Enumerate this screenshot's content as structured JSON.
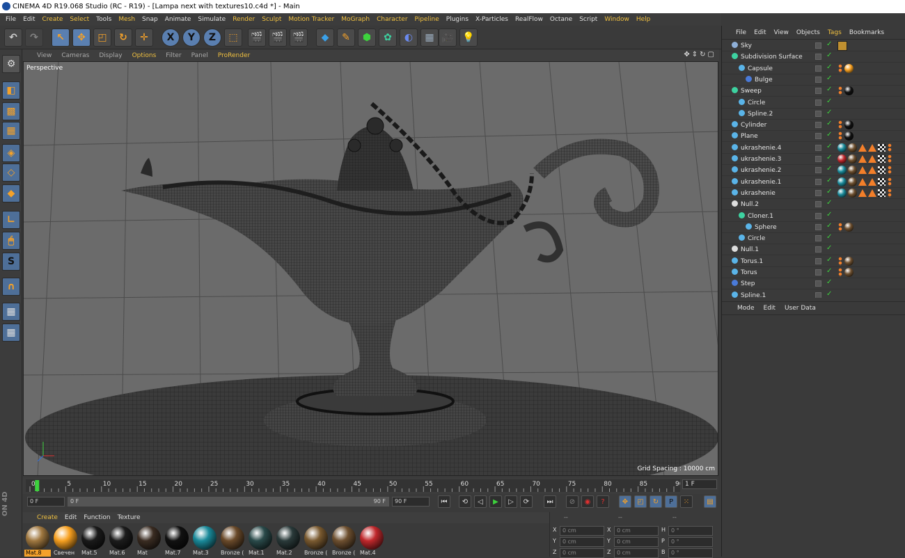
{
  "window": {
    "title": "CINEMA 4D R19.068 Studio (RC - R19) - [Lampa next with textures10.c4d *] - Main"
  },
  "menubar": [
    "File",
    "Edit",
    "Create",
    "Select",
    "Tools",
    "Mesh",
    "Snap",
    "Animate",
    "Simulate",
    "Render",
    "Sculpt",
    "Motion Tracker",
    "MoGraph",
    "Character",
    "Pipeline",
    "Plugins",
    "X-Particles",
    "RealFlow",
    "Octane",
    "Script",
    "Window",
    "Help"
  ],
  "toolbar": {
    "axis": [
      "X",
      "Y",
      "Z"
    ]
  },
  "viewport": {
    "menu": [
      "View",
      "Cameras",
      "Display",
      "Options",
      "Filter",
      "Panel",
      "ProRender"
    ],
    "label": "Perspective",
    "grid_spacing": "Grid Spacing : 10000 cm"
  },
  "timeline": {
    "ticks": [
      "0",
      "5",
      "10",
      "15",
      "20",
      "25",
      "30",
      "35",
      "40",
      "45",
      "50",
      "55",
      "60",
      "65",
      "70",
      "75",
      "80",
      "85",
      "90"
    ],
    "current_frame": "1 F",
    "start": "0 F",
    "range_start": "0 F",
    "range_end": "90 F",
    "end": "90 F"
  },
  "material_panel": {
    "menu": [
      "Create",
      "Edit",
      "Function",
      "Texture"
    ],
    "materials": [
      {
        "name": "Mat.8",
        "color": "#a07840"
      },
      {
        "name": "Свечен",
        "color": "#f7a020"
      },
      {
        "name": "Mat.5",
        "color": "#1a1a1a"
      },
      {
        "name": "Mat.6",
        "color": "#1c1c1c"
      },
      {
        "name": "Mat",
        "color": "#3a2c22"
      },
      {
        "name": "Mat.7",
        "color": "#111111"
      },
      {
        "name": "Mat.3",
        "color": "#1a8a9a"
      },
      {
        "name": "Bronze (",
        "color": "#6a4a2a"
      },
      {
        "name": "Mat.1",
        "color": "#2a4a4a"
      },
      {
        "name": "Mat.2",
        "color": "#2a3a3a"
      },
      {
        "name": "Bronze (",
        "color": "#7a5a30"
      },
      {
        "name": "Bronze (",
        "color": "#6e5030"
      },
      {
        "name": "Mat.4",
        "color": "#c0282c"
      }
    ]
  },
  "coords": {
    "headers": [
      "--",
      "--",
      "--"
    ],
    "rows": [
      {
        "a": "X",
        "av": "0 cm",
        "b": "X",
        "bv": "0 cm",
        "c": "H",
        "cv": "0 °"
      },
      {
        "a": "Y",
        "av": "0 cm",
        "b": "Y",
        "bv": "0 cm",
        "c": "P",
        "cv": "0 °"
      },
      {
        "a": "Z",
        "av": "0 cm",
        "b": "Z",
        "bv": "0 cm",
        "c": "B",
        "cv": "0 °"
      }
    ]
  },
  "object_manager": {
    "menu": [
      "File",
      "Edit",
      "View",
      "Objects",
      "Tags",
      "Bookmarks"
    ],
    "objects": [
      {
        "name": "Sky",
        "indent": 0,
        "icon": "#8fb0d8",
        "tags": [
          "img"
        ]
      },
      {
        "name": "Subdivision Surface",
        "indent": 0,
        "icon": "#3dd2a0",
        "tags": []
      },
      {
        "name": "Capsule",
        "indent": 1,
        "icon": "#5ab4e8",
        "tags": [
          "dot",
          "orange"
        ]
      },
      {
        "name": "Bulge",
        "indent": 2,
        "icon": "#4a7ad8",
        "tags": []
      },
      {
        "name": "Sweep",
        "indent": 0,
        "icon": "#3dd2a0",
        "tags": [
          "dot",
          "black"
        ]
      },
      {
        "name": "Circle",
        "indent": 1,
        "icon": "#5ab4e8",
        "tags": []
      },
      {
        "name": "Spline.2",
        "indent": 1,
        "icon": "#5ab4e8",
        "tags": []
      },
      {
        "name": "Cylinder",
        "indent": 0,
        "icon": "#5ab4e8",
        "tags": [
          "dot",
          "black"
        ]
      },
      {
        "name": "Plane",
        "indent": 0,
        "icon": "#5ab4e8",
        "tags": [
          "dot",
          "black"
        ]
      },
      {
        "name": "ukrashenie.4",
        "indent": 0,
        "icon": "#5ab4e8",
        "tags": [
          "teal",
          "bronze",
          "tri",
          "tri",
          "chk",
          "dot"
        ]
      },
      {
        "name": "ukrashenie.3",
        "indent": 0,
        "icon": "#5ab4e8",
        "tags": [
          "red",
          "bronze",
          "tri",
          "tri",
          "chk",
          "dot"
        ]
      },
      {
        "name": "ukrashenie.2",
        "indent": 0,
        "icon": "#5ab4e8",
        "tags": [
          "teal",
          "bronze",
          "tri",
          "tri",
          "chk",
          "dot"
        ]
      },
      {
        "name": "ukrashenie.1",
        "indent": 0,
        "icon": "#5ab4e8",
        "tags": [
          "teal",
          "bronze",
          "tri",
          "tri",
          "chk",
          "dot"
        ]
      },
      {
        "name": "ukrashenie",
        "indent": 0,
        "icon": "#5ab4e8",
        "tags": [
          "teal",
          "bronze",
          "tri",
          "tri",
          "chk",
          "dot"
        ]
      },
      {
        "name": "Null.2",
        "indent": 0,
        "icon": "#dddddd",
        "tags": []
      },
      {
        "name": "Cloner.1",
        "indent": 1,
        "icon": "#3dd2a0",
        "tags": []
      },
      {
        "name": "Sphere",
        "indent": 2,
        "icon": "#5ab4e8",
        "tags": [
          "dot",
          "bronze"
        ]
      },
      {
        "name": "Circle",
        "indent": 1,
        "icon": "#5ab4e8",
        "tags": []
      },
      {
        "name": "Null.1",
        "indent": 0,
        "icon": "#dddddd",
        "tags": []
      },
      {
        "name": "Torus.1",
        "indent": 0,
        "icon": "#5ab4e8",
        "tags": [
          "dot",
          "bronze"
        ]
      },
      {
        "name": "Torus",
        "indent": 0,
        "icon": "#5ab4e8",
        "tags": [
          "dot",
          "bronze"
        ]
      },
      {
        "name": "Step",
        "indent": 0,
        "icon": "#4a7ad8",
        "tags": []
      },
      {
        "name": "Spline.1",
        "indent": 0,
        "icon": "#5ab4e8",
        "tags": []
      }
    ]
  },
  "attribute_manager": {
    "menu": [
      "Mode",
      "Edit",
      "User Data"
    ]
  },
  "side_brand": "ON 4D",
  "colors": {
    "accent": "#f0c040",
    "selection": "#f3a12a",
    "tool_blue": "#4e6f98"
  }
}
